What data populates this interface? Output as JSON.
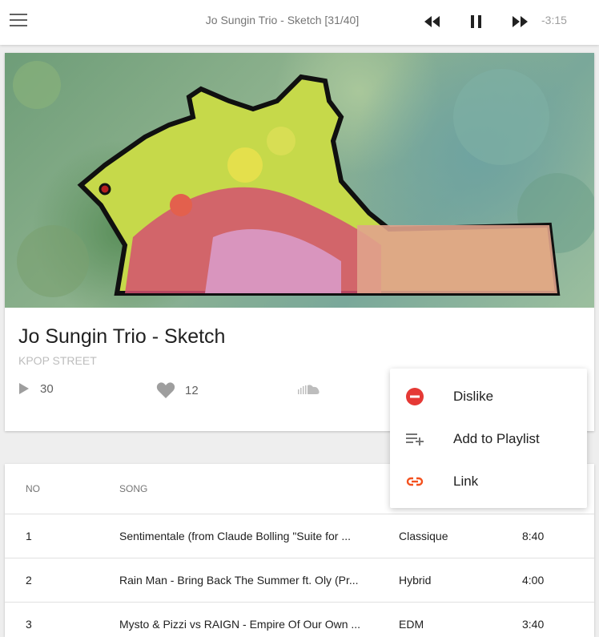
{
  "header": {
    "now_playing": "Jo Sungin Trio - Sketch [31/40]",
    "time_remaining": "-3:15",
    "icons": {
      "menu": "hamburger-icon",
      "prev": "rewind-icon",
      "pause": "pause-icon",
      "next": "fast-forward-icon"
    }
  },
  "song": {
    "title": "Jo Sungin Trio - Sketch",
    "artist": "KPOP STREET",
    "plays": "30",
    "likes": "12",
    "source_icon": "soundcloud-icon"
  },
  "context_menu": {
    "items": [
      {
        "label": "Dislike",
        "icon": "dislike-icon",
        "color": "#e53935"
      },
      {
        "label": "Add to Playlist",
        "icon": "playlist-add-icon",
        "color": "#616161"
      },
      {
        "label": "Link",
        "icon": "link-icon",
        "color": "#f4511e"
      }
    ]
  },
  "table": {
    "headers": {
      "no": "NO",
      "song": "SONG"
    },
    "rows": [
      {
        "no": "1",
        "song": "Sentimentale (from Claude Bolling \"Suite for ...",
        "genre": "Classique",
        "duration": "8:40"
      },
      {
        "no": "2",
        "song": "Rain Man - Bring Back The Summer ft. Oly (Pr...",
        "genre": "Hybrid",
        "duration": "4:00"
      },
      {
        "no": "3",
        "song": "Mysto & Pizzi vs RAIGN - Empire Of Our Own ...",
        "genre": "EDM",
        "duration": "3:40"
      }
    ]
  }
}
